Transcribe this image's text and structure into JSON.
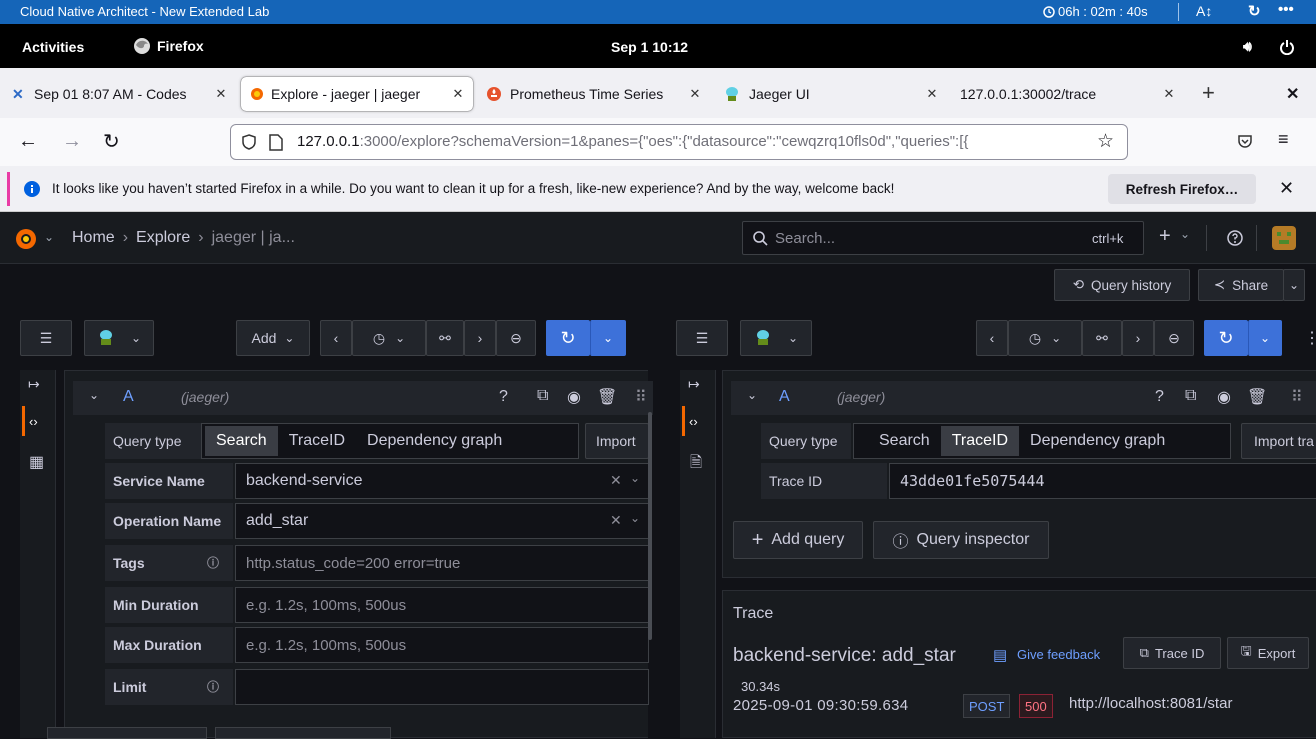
{
  "lab": {
    "title": "Cloud Native Architect - New Extended Lab",
    "timer": "06h : 02m : 40s"
  },
  "gnome": {
    "activities": "Activities",
    "app": "Firefox",
    "clock": "Sep 1  10:12"
  },
  "tabs": [
    {
      "label": "Sep 01 8:07 AM - Codes"
    },
    {
      "label": "Explore - jaeger | jaeger"
    },
    {
      "label": "Prometheus Time Series"
    },
    {
      "label": "Jaeger UI"
    },
    {
      "label": "127.0.0.1:30002/trace"
    }
  ],
  "url": {
    "host": "127.0.0.1",
    "rest": ":3000/explore?schemaVersion=1&panes={\"oes\":{\"datasource\":\"cewqzrq10fls0d\",\"queries\":[{"
  },
  "notification": {
    "text": "It looks like you haven’t started Firefox in a while. Do you want to clean it up for a fresh, like-new experience? And by the way, welcome back!",
    "button": "Refresh Firefox…"
  },
  "grafana": {
    "breadcrumb": {
      "home": "Home",
      "explore": "Explore",
      "current": "jaeger | ja..."
    },
    "search": {
      "placeholder": "Search...",
      "shortcut": "ctrl+k"
    },
    "query_history": "Query history",
    "share": "Share",
    "add": "Add"
  },
  "left": {
    "query_letter": "A",
    "datasource": "(jaeger)",
    "query_type_label": "Query type",
    "query_types": [
      "Search",
      "TraceID",
      "Dependency graph"
    ],
    "import": "Import",
    "fields": {
      "service_label": "Service Name",
      "service_value": "backend-service",
      "operation_label": "Operation Name",
      "operation_value": "add_star",
      "tags_label": "Tags",
      "tags_placeholder": "http.status_code=200 error=true",
      "min_label": "Min Duration",
      "min_placeholder": "e.g. 1.2s, 100ms, 500us",
      "max_label": "Max Duration",
      "max_placeholder": "e.g. 1.2s, 100ms, 500us",
      "limit_label": "Limit"
    }
  },
  "right": {
    "query_letter": "A",
    "datasource": "(jaeger)",
    "query_type_label": "Query type",
    "query_types": [
      "Search",
      "TraceID",
      "Dependency graph"
    ],
    "import": "Import tra",
    "trace_id_label": "Trace ID",
    "trace_id_value": "43dde01fe5075444",
    "add_query": "Add query",
    "query_inspector": "Query inspector",
    "trace": {
      "section": "Trace",
      "title": "backend-service: add_star",
      "feedback": "Give feedback",
      "trace_id_btn": "Trace ID",
      "export": "Export",
      "duration": "30.34s",
      "timestamp": "2025-09-01 09:30:59.634",
      "method": "POST",
      "status": "500",
      "url": "http://localhost:8081/star"
    }
  }
}
